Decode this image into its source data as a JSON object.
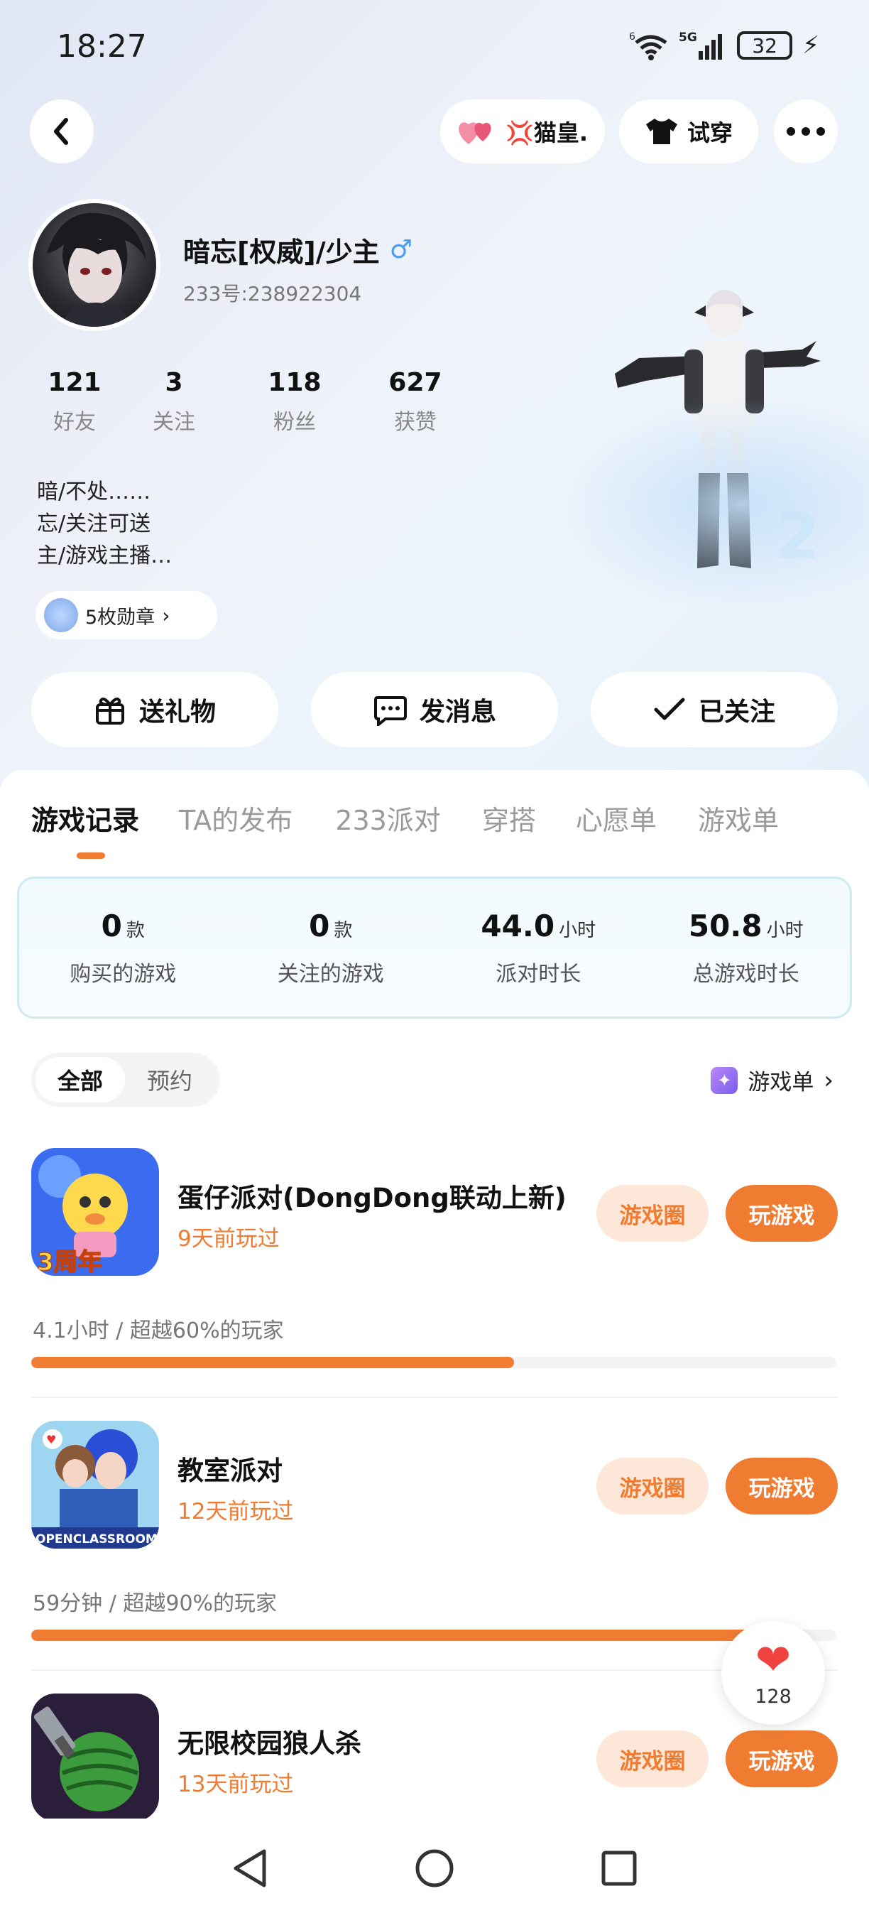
{
  "status_bar": {
    "time": "18:27",
    "network_label": "5G",
    "wifi_label": "6",
    "battery": "32"
  },
  "header": {
    "following_tag": "💢猫皇.",
    "tryon_label": "试穿"
  },
  "profile": {
    "username": "暗忘[权威]/少主",
    "gender_symbol": "♂",
    "uid": "233号:238922304",
    "stats": [
      {
        "value": "121",
        "label": "好友"
      },
      {
        "value": "3",
        "label": "关注"
      },
      {
        "value": "118",
        "label": "粉丝"
      },
      {
        "value": "627",
        "label": "获赞"
      }
    ],
    "bio": [
      "暗/不处……",
      "忘/关注可送",
      "主/游戏主播…"
    ],
    "badges_label": "5枚勋章"
  },
  "actions": {
    "gift": "送礼物",
    "message": "发消息",
    "followed": "已关注"
  },
  "tabs": [
    "游戏记录",
    "TA的发布",
    "233派对",
    "穿搭",
    "心愿单",
    "游戏单"
  ],
  "summary": [
    {
      "value": "0",
      "unit": "款",
      "label": "购买的游戏"
    },
    {
      "value": "0",
      "unit": "款",
      "label": "关注的游戏"
    },
    {
      "value": "44.0",
      "unit": "小时",
      "label": "派对时长"
    },
    {
      "value": "50.8",
      "unit": "小时",
      "label": "总游戏时长"
    }
  ],
  "filter": {
    "all": "全部",
    "reserve": "预约"
  },
  "game_list_link": "游戏单",
  "games": [
    {
      "title": "蛋仔派对(DongDong联动上新)",
      "last_played": "9天前玩过",
      "circle_label": "游戏圈",
      "play_label": "玩游戏",
      "stat": "4.1小时 / 超越60%的玩家",
      "progress": 0.6
    },
    {
      "title": "教室派对",
      "last_played": "12天前玩过",
      "circle_label": "游戏圈",
      "play_label": "玩游戏",
      "stat": "59分钟 / 超越90%的玩家",
      "progress": 0.9
    },
    {
      "title": "无限校园狼人杀",
      "last_played": "13天前玩过",
      "circle_label": "游戏圈",
      "play_label": "玩游戏",
      "stat": "",
      "progress": null
    }
  ],
  "like_float": {
    "count": "128"
  },
  "colors": {
    "accent": "#f07c32",
    "accent_light": "#fde7d8",
    "heart": "#f0433f"
  }
}
